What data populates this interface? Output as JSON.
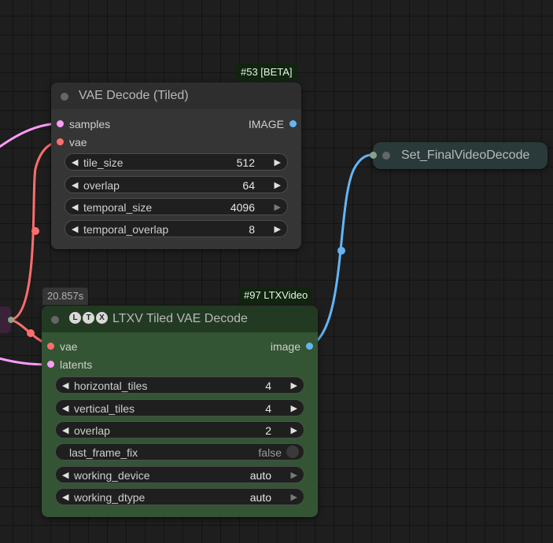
{
  "nodes": {
    "vae_decode_tiled": {
      "id_badge": "#53 [BETA]",
      "title": "VAE Decode (Tiled)",
      "inputs": [
        "samples",
        "vae"
      ],
      "output": "IMAGE",
      "widgets": [
        {
          "label": "tile_size",
          "value": "512"
        },
        {
          "label": "overlap",
          "value": "64"
        },
        {
          "label": "temporal_size",
          "value": "4096"
        },
        {
          "label": "temporal_overlap",
          "value": "8"
        }
      ]
    },
    "set_final_video_decode": {
      "title": "Set_FinalVideoDecode"
    },
    "ltxv_tiled_vae_decode": {
      "time_badge": "20.857s",
      "id_badge": "#97 LTXVideo",
      "icon_letters": [
        "L",
        "T",
        "X"
      ],
      "title": "LTXV Tiled VAE Decode",
      "inputs": [
        "vae",
        "latents"
      ],
      "output": "image",
      "widgets": [
        {
          "label": "horizontal_tiles",
          "value": "4"
        },
        {
          "label": "vertical_tiles",
          "value": "4"
        },
        {
          "label": "overlap",
          "value": "2"
        },
        {
          "label": "last_frame_fix",
          "value": "false"
        },
        {
          "label": "working_device",
          "value": "auto"
        },
        {
          "label": "working_dtype",
          "value": "auto"
        }
      ]
    }
  },
  "icons": {
    "left_arrow": "◀",
    "right_arrow": "▶"
  },
  "colors": {
    "canvas": "#1e1e1e",
    "node_gray": "#353535",
    "node_gray_title": "#2e2e2e",
    "node_green": "#335533",
    "node_green_title": "#223a22",
    "set_node": "#2a3a3a",
    "latent_wire": "#ff9cf9",
    "vae_wire": "#ff6e6e",
    "image_wire": "#64b5f6"
  }
}
